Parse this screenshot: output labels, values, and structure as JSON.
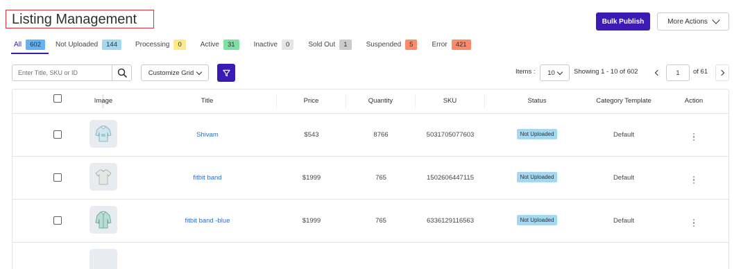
{
  "header": {
    "title": "Listing Management",
    "bulk_publish_label": "Bulk Publish",
    "more_actions_label": "More Actions"
  },
  "tabs": [
    {
      "label": "All",
      "count": "602",
      "color": "#62b3f3"
    },
    {
      "label": "Not Uploaded",
      "count": "144",
      "color": "#a4d8f0"
    },
    {
      "label": "Processing",
      "count": "0",
      "color": "#ffea8a"
    },
    {
      "label": "Active",
      "count": "31",
      "color": "#7fe0a3"
    },
    {
      "label": "Inactive",
      "count": "0",
      "color": "#e4e5e7"
    },
    {
      "label": "Sold Out",
      "count": "1",
      "color": "#c9cccf"
    },
    {
      "label": "Suspended",
      "count": "5",
      "color": "#fd8a6b"
    },
    {
      "label": "Error",
      "count": "421",
      "color": "#fd8a6b"
    }
  ],
  "toolbar": {
    "search_placeholder": "Enter Title, SKU or ID",
    "customize_grid_label": "Customize Grid",
    "items_label": "Items :",
    "items_per_page": "10",
    "showing_text": "Showing 1 - 10 of 602",
    "current_page": "1",
    "total_pages_text": "of  61"
  },
  "table": {
    "headers": {
      "image": "Image",
      "title": "Title",
      "price": "Price",
      "quantity": "Quantity",
      "sku": "SKU",
      "status": "Status",
      "category_template": "Category Template",
      "action": "Action"
    },
    "rows": [
      {
        "title": "Shivam",
        "price": "$543",
        "quantity": "8766",
        "sku": "5031705077603",
        "status": "Not Uploaded",
        "category": "Default",
        "image_icon": "hoodie-icon"
      },
      {
        "title": "fitbit band",
        "price": "$1999",
        "quantity": "765",
        "sku": "1502606447115",
        "status": "Not Uploaded",
        "category": "Default",
        "image_icon": "tshirt-icon"
      },
      {
        "title": "fitbit band -blue",
        "price": "$1999",
        "quantity": "765",
        "sku": "6336129116563",
        "status": "Not Uploaded",
        "category": "Default",
        "image_icon": "jacket-icon"
      }
    ]
  },
  "colors": {
    "brand": "#3c1bb5",
    "link": "#2c6ecb",
    "title_highlight_border": "#d9303b",
    "status_not_uploaded": "#a4d8f0"
  }
}
